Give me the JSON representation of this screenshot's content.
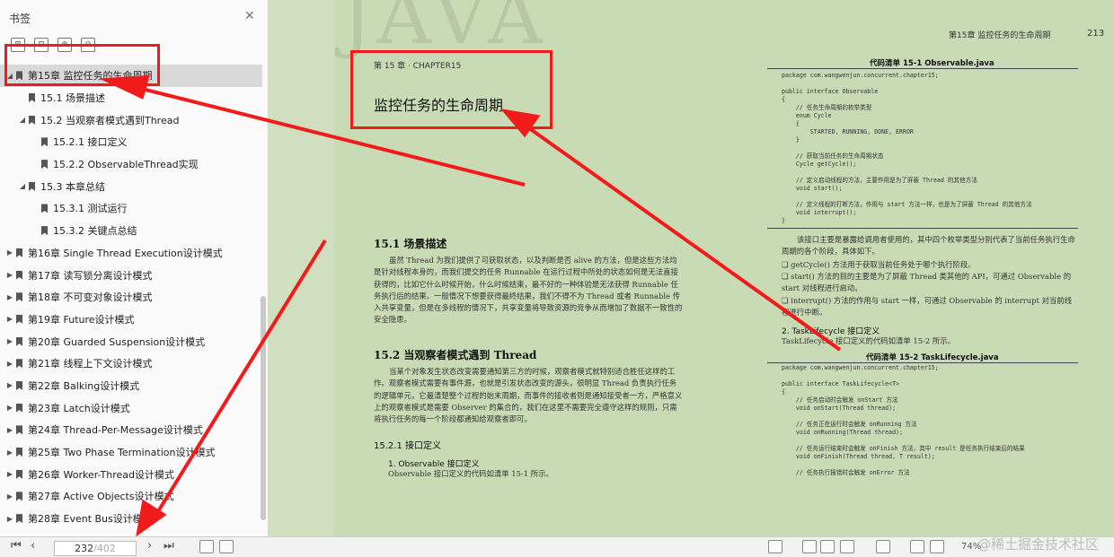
{
  "sidebar": {
    "title": "书签",
    "items": [
      {
        "label": "第15章 监控任务的生命周期",
        "level": 0,
        "twisty": "◢",
        "selected": true
      },
      {
        "label": "15.1 场景描述",
        "level": 1,
        "twisty": ""
      },
      {
        "label": "15.2 当观察者模式遇到Thread",
        "level": 1,
        "twisty": "◢"
      },
      {
        "label": "15.2.1 接口定义",
        "level": 2,
        "twisty": ""
      },
      {
        "label": "15.2.2 ObservableThread实现",
        "level": 2,
        "twisty": ""
      },
      {
        "label": "15.3 本章总结",
        "level": 1,
        "twisty": "◢"
      },
      {
        "label": "15.3.1 测试运行",
        "level": 2,
        "twisty": ""
      },
      {
        "label": "15.3.2 关键点总结",
        "level": 2,
        "twisty": ""
      },
      {
        "label": "第16章 Single Thread Execution设计模式",
        "level": 0,
        "twisty": "▶"
      },
      {
        "label": "第17章 读写锁分离设计模式",
        "level": 0,
        "twisty": "▶"
      },
      {
        "label": "第18章 不可变对象设计模式",
        "level": 0,
        "twisty": "▶"
      },
      {
        "label": "第19章 Future设计模式",
        "level": 0,
        "twisty": "▶"
      },
      {
        "label": "第20章 Guarded Suspension设计模式",
        "level": 0,
        "twisty": "▶"
      },
      {
        "label": "第21章 线程上下文设计模式",
        "level": 0,
        "twisty": "▶"
      },
      {
        "label": "第22章 Balking设计模式",
        "level": 0,
        "twisty": "▶"
      },
      {
        "label": "第23章 Latch设计模式",
        "level": 0,
        "twisty": "▶"
      },
      {
        "label": "第24章 Thread-Per-Message设计模式",
        "level": 0,
        "twisty": "▶"
      },
      {
        "label": "第25章 Two Phase Termination设计模式",
        "level": 0,
        "twisty": "▶"
      },
      {
        "label": "第26章 Worker-Thread设计模式",
        "level": 0,
        "twisty": "▶"
      },
      {
        "label": "第27章 Active Objects设计模式",
        "level": 0,
        "twisty": "▶"
      },
      {
        "label": "第28章 Event Bus设计模式",
        "level": 0,
        "twisty": "▶"
      }
    ]
  },
  "page": {
    "bg_word": "JAVA",
    "header_right": "第15章  监控任务的生命周期",
    "header_num": "213",
    "chapter_small": "第 15 章 · CHAPTER15",
    "chapter_title": "监控任务的生命周期",
    "s1_title": "15.1   场景描述",
    "s1_text": "虽然 Thread 为我们提供了可获取状态，以及判断是否 alive 的方法，但是这些方法均是针对线程本身的，而我们提交的任务 Runnable 在运行过程中所处的状态如何是无法直接获得的，比如它什么时候开始，什么时候结束，最不好的一种体验是无法获得 Runnable 任务执行后的结果。一般情况下想要获得最终结果，我们不得不为 Thread 或者 Runnable 传入共享变量，但是在多线程的情况下，共享变量将导致资源的竞争从而增加了数据不一致性的安全隐患。",
    "s2_title": "15.2   当观察者模式遇到 Thread",
    "s2_text": "当某个对象发生状态改变需要通知第三方的时候，观察者模式就特别适合胜任这样的工作。观察者模式需要有事件源，也就是引发状态改变的源头，很明显 Thread 负责执行任务的逻辑单元，它最清楚整个过程的始末周期，而事件的接收者则是通知接受者一方，严格意义上的观察者模式是需要 Observer 的集合的，我们在这里不需要完全遵守这样的规则，只需将执行任务的每一个阶段都通知给观察者即可。",
    "s21_title": "15.2.1   接口定义",
    "s21_sub": "1. Observable 接口定义",
    "s21_text": "Observable 接口定义的代码如清单 15-1 所示。",
    "code1_caption": "代码清单 15-1   Observable.java",
    "code1": "package com.wangwenjun.concurrent.chapter15;\n\npublic interface Observable\n{\n    // 任务生命周期的枚举类型\n    enum Cycle\n    {\n        STARTED, RUNNING, DONE, ERROR\n    }\n\n    // 获取当前任务的生命周期状态\n    Cycle getCycle();\n\n    // 定义启动线程的方法，主要作用是为了屏蔽 Thread 的其他方法\n    void start();\n\n    // 定义线程的打断方法，作用与 start 方法一样，也是为了屏蔽 Thread 的其他方法\n    void interrupt();\n}",
    "right_text": "该接口主要是暴露给调用者使用的，其中四个枚举类型分别代表了当前任务执行生命周期的各个阶段，具体如下。",
    "bullets": [
      "❑ getCycle() 方法用于获取当前任务处于哪个执行阶段。",
      "❑ start() 方法的目的主要是为了屏蔽 Thread 类其他的 API，可通过 Observable 的 start 对线程进行启动。",
      "❑ interrupt() 方法的作用与 start 一样，可通过 Observable 的 interrupt 对当前线程进行中断。"
    ],
    "s22_sub": "2. TaskLifecycle 接口定义",
    "s22_text": "TaskLifecycle 接口定义的代码如清单 15-2 所示。",
    "code2_caption": "代码清单 15-2   TaskLifecycle.java",
    "code2": "package com.wangwenjun.concurrent.chapter15;\n\npublic interface TaskLifecycle<T>\n{\n    // 任务启动时会触发 onStart 方法\n    void onStart(Thread thread);\n\n    // 任务正在运行时会触发 onRunning 方法\n    void onRunning(Thread thread);\n\n    // 任务运行结束时会触发 onFinish 方法，其中 result 是任务执行结束后的结果\n    void onFinish(Thread thread, T result);\n\n    // 任务执行报错时会触发 onError 方法"
  },
  "bottom": {
    "current_page": "232",
    "total_pages": "/402",
    "zoom": "74%",
    "watermark": "@稀土掘金技术社区"
  },
  "colors": {
    "accent_red": "#f21b1b",
    "page_bg": "#c9dbb5"
  }
}
